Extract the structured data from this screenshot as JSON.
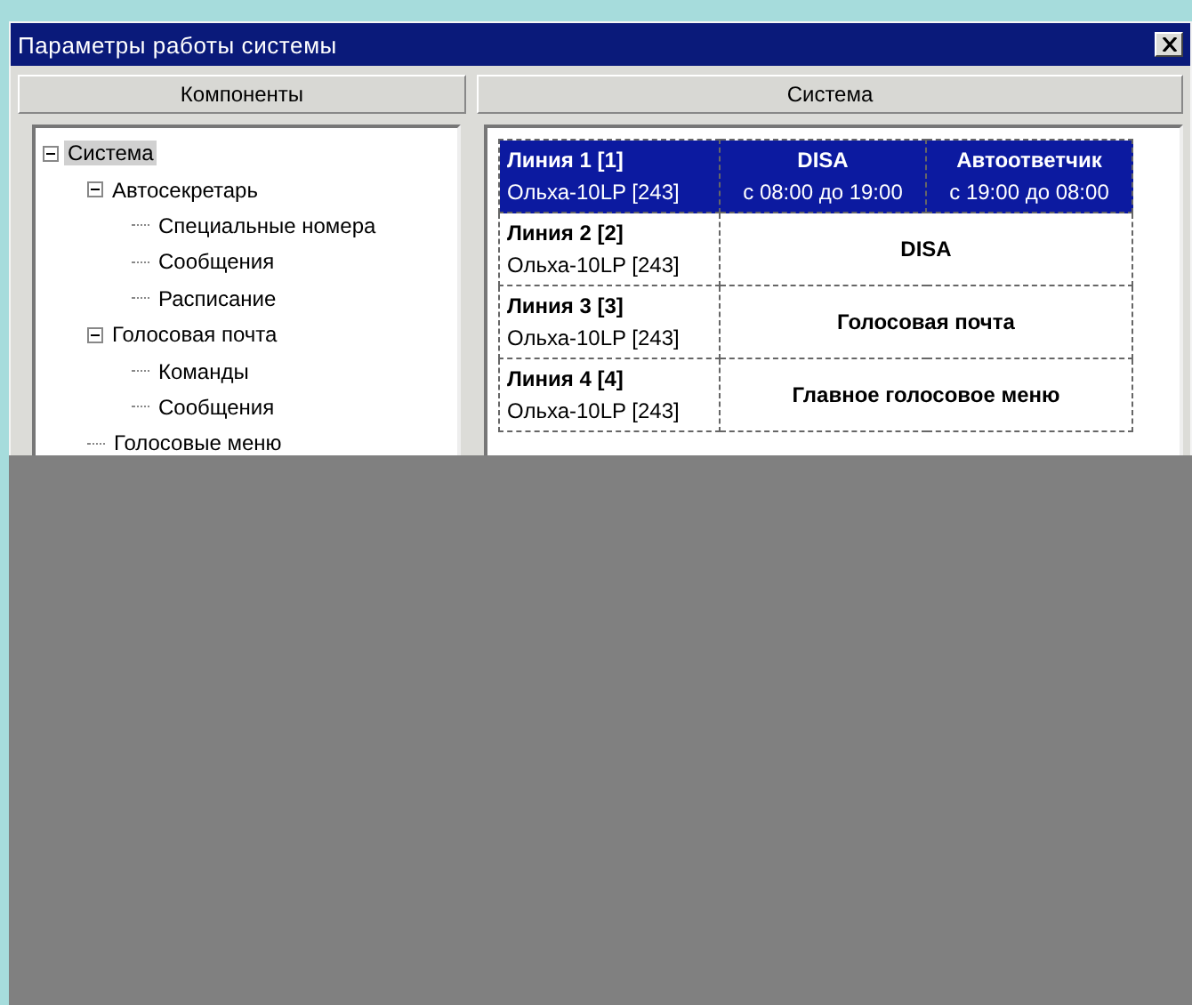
{
  "window": {
    "title": "Параметры работы системы"
  },
  "components_panel": {
    "header": "Компоненты",
    "tree": [
      {
        "label": "Система",
        "selected": true,
        "expanded": true,
        "children": [
          {
            "label": "Автосекретарь",
            "selected": false,
            "expanded": true,
            "children": [
              {
                "label": "Специальные номера",
                "selected": false
              },
              {
                "label": "Сообщения",
                "selected": false
              },
              {
                "label": "Расписание",
                "selected": false
              }
            ]
          },
          {
            "label": "Голосовая почта",
            "selected": false,
            "expanded": true,
            "children": [
              {
                "label": "Команды",
                "selected": false
              },
              {
                "label": "Сообщения",
                "selected": false
              }
            ]
          },
          {
            "label": "Голосовые меню",
            "selected": false
          }
        ]
      }
    ]
  },
  "system_panel": {
    "header": "Система",
    "lines": [
      {
        "name": "Линия 1 [1]",
        "device": "Ольха-10LP [243]",
        "selected": true,
        "modes": [
          {
            "label": "DISA",
            "schedule": "с 08:00 до 19:00"
          },
          {
            "label": "Автоответчик",
            "schedule": "с 19:00 до 08:00"
          }
        ]
      },
      {
        "name": "Линия 2 [2]",
        "device": "Ольха-10LP [243]",
        "selected": false,
        "modes": [
          {
            "label": "DISA"
          }
        ]
      },
      {
        "name": "Линия 3 [3]",
        "device": "Ольха-10LP [243]",
        "selected": false,
        "modes": [
          {
            "label": "Голосовая почта"
          }
        ]
      },
      {
        "name": "Линия 4 [4]",
        "device": "Ольха-10LP [243]",
        "selected": false,
        "modes": [
          {
            "label": "Главное голосовое меню"
          }
        ]
      }
    ]
  }
}
